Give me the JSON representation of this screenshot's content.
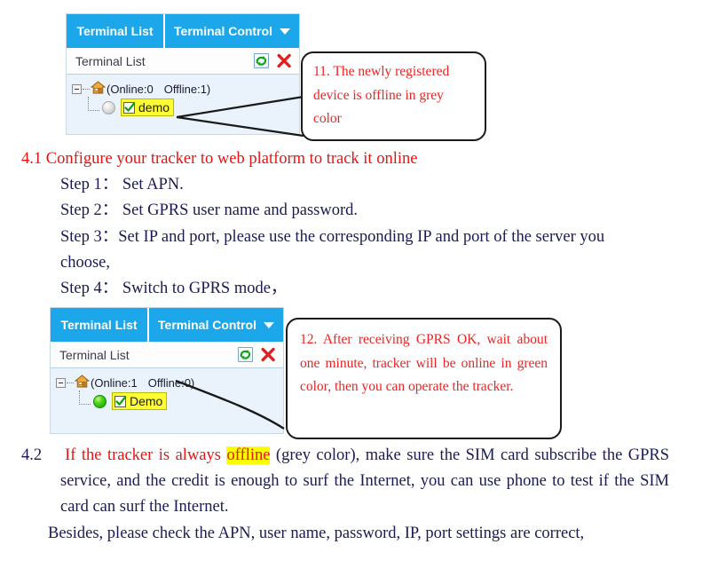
{
  "widgets": [
    {
      "name": "terminal-list-offline",
      "tabs": [
        {
          "label": "Terminal List",
          "has_caret": false
        },
        {
          "label": "Terminal Control",
          "has_caret": true
        }
      ],
      "panel_title": "Terminal List",
      "icons": {
        "refresh": "refresh-icon",
        "close": "close-icon"
      },
      "tree": {
        "root_icon": "home-icon",
        "online_label": "(Online:0",
        "offline_label": "Offline:1)",
        "device": {
          "name": "demo",
          "status": "offline",
          "checked": true
        }
      }
    },
    {
      "name": "terminal-list-online",
      "tabs": [
        {
          "label": "Terminal List",
          "has_caret": false
        },
        {
          "label": "Terminal Control",
          "has_caret": true
        }
      ],
      "panel_title": "Terminal List",
      "icons": {
        "refresh": "refresh-icon",
        "close": "close-icon"
      },
      "tree": {
        "root_icon": "home-icon",
        "online_label": "(Online:1",
        "offline_label": "Offline:0)",
        "device": {
          "name": "Demo",
          "status": "online",
          "checked": true
        }
      }
    }
  ],
  "callouts": [
    {
      "name": "callout-11",
      "text": "11. The newly registered device is offline in grey color"
    },
    {
      "name": "callout-12",
      "text": "12. After receiving GPRS OK, wait about one minute, tracker will be online in green color, then you can operate the tracker."
    }
  ],
  "document": {
    "section_41": {
      "heading": "4.1 Configure your tracker to web platform to track it online",
      "steps": [
        "Step 1： Set APN.",
        "Step 2： Set GPRS user name and password.",
        "Step 3：Set IP and port, please use the corresponding IP and port of the server you choose,",
        "Step 4： Switch to GPRS mode，"
      ]
    },
    "section_42": {
      "number": "4.2",
      "red_lead": "If the tracker is always",
      "highlight": "offline",
      "body": "(grey color), make sure the SIM card subscribe the GPRS service, and the credit is enough to surf the Internet, you can use phone to test if the SIM card can surf the Internet.",
      "second_para": "Besides, please check the APN, user name, password, IP, port settings are correct,"
    }
  },
  "colors": {
    "tab_blue": "#1ca7ea",
    "panel_bg": "#eaf3fb",
    "highlight_yellow": "#ffff00",
    "red_text": "#ee1111",
    "navy_text": "#1b1b54",
    "online_green": "#49d215",
    "offline_grey": "#c8c8c8"
  }
}
